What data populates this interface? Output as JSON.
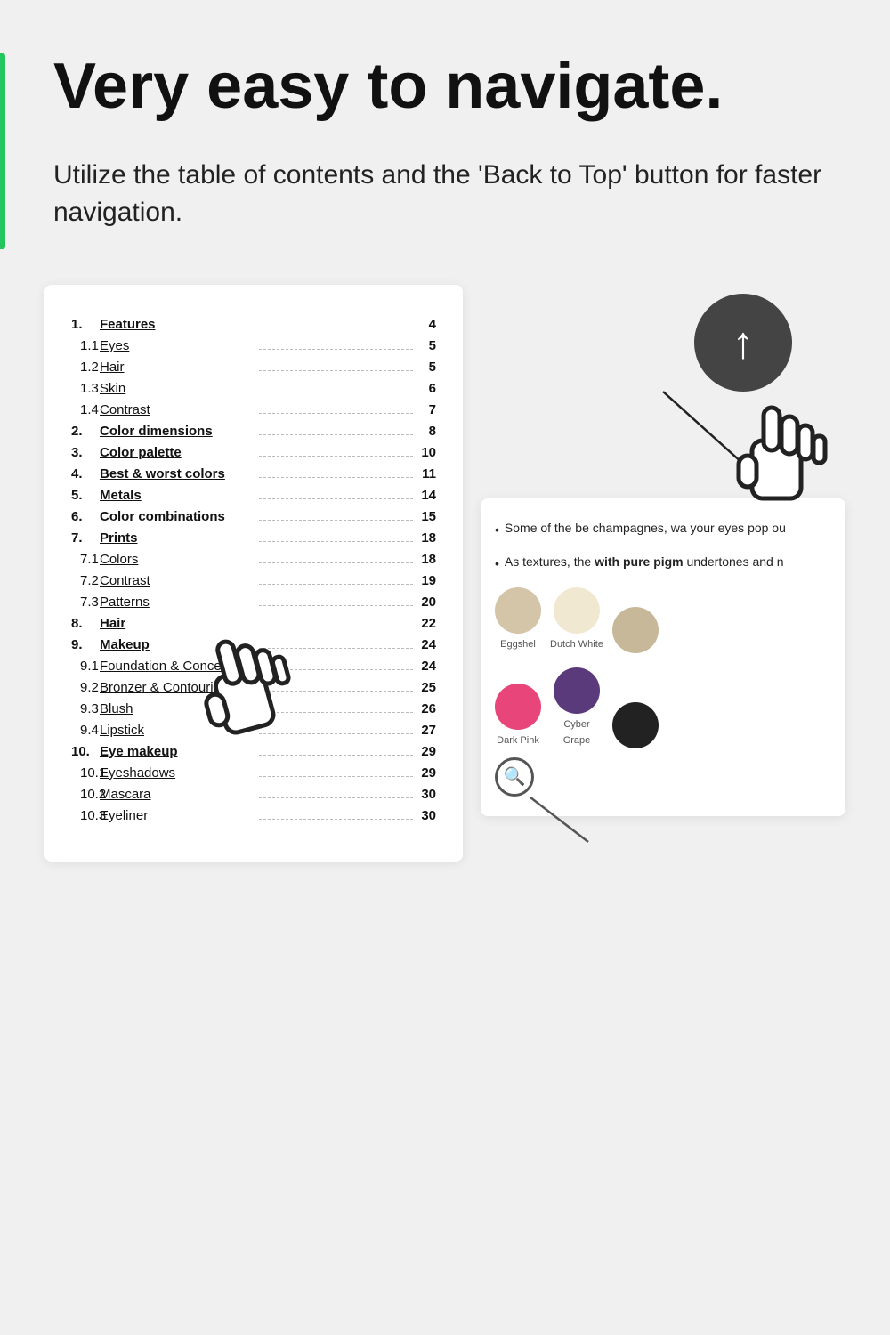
{
  "hero": {
    "title": "Very easy to navigate.",
    "subtitle": "Utilize the table of contents and the 'Back to Top' button for faster navigation."
  },
  "toc": {
    "items": [
      {
        "num": "1.",
        "label": "Features",
        "page": "4",
        "bold": true,
        "indent": 0
      },
      {
        "num": "1.1",
        "label": "Eyes",
        "page": "5",
        "bold": false,
        "indent": 1
      },
      {
        "num": "1.2",
        "label": "Hair",
        "page": "5",
        "bold": false,
        "indent": 1
      },
      {
        "num": "1.3",
        "label": "Skin",
        "page": "6",
        "bold": false,
        "indent": 1
      },
      {
        "num": "1.4",
        "label": "Contrast",
        "page": "7",
        "bold": false,
        "indent": 1
      },
      {
        "num": "2.",
        "label": "Color dimensions",
        "page": "8",
        "bold": true,
        "indent": 0
      },
      {
        "num": "3.",
        "label": "Color palette",
        "page": "10",
        "bold": true,
        "indent": 0
      },
      {
        "num": "4.",
        "label": "Best & worst colors",
        "page": "11",
        "bold": true,
        "indent": 0
      },
      {
        "num": "5.",
        "label": "Metals",
        "page": "14",
        "bold": true,
        "indent": 0
      },
      {
        "num": "6.",
        "label": "Color combinations",
        "page": "15",
        "bold": true,
        "indent": 0
      },
      {
        "num": "7.",
        "label": "Prints",
        "page": "18",
        "bold": true,
        "indent": 0
      },
      {
        "num": "7.1",
        "label": "Colors",
        "page": "18",
        "bold": false,
        "indent": 1
      },
      {
        "num": "7.2",
        "label": "Contrast",
        "page": "19",
        "bold": false,
        "indent": 1
      },
      {
        "num": "7.3",
        "label": "Patterns",
        "page": "20",
        "bold": false,
        "indent": 1
      },
      {
        "num": "8.",
        "label": "Hair",
        "page": "22",
        "bold": true,
        "indent": 0
      },
      {
        "num": "9.",
        "label": "Makeup",
        "page": "24",
        "bold": true,
        "indent": 0
      },
      {
        "num": "9.1",
        "label": "Foundation & Concealer",
        "page": "24",
        "bold": false,
        "indent": 1
      },
      {
        "num": "9.2",
        "label": "Bronzer & Contouring",
        "page": "25",
        "bold": false,
        "indent": 1
      },
      {
        "num": "9.3",
        "label": "Blush",
        "page": "26",
        "bold": false,
        "indent": 1
      },
      {
        "num": "9.4",
        "label": "Lipstick",
        "page": "27",
        "bold": false,
        "indent": 1
      },
      {
        "num": "10.",
        "label": "Eye makeup",
        "page": "29",
        "bold": true,
        "indent": 0
      },
      {
        "num": "10.1",
        "label": "Eyeshadows",
        "page": "29",
        "bold": false,
        "indent": 1
      },
      {
        "num": "10.2",
        "label": "Mascara",
        "page": "30",
        "bold": false,
        "indent": 1
      },
      {
        "num": "10.3",
        "label": "Eyeliner",
        "page": "30",
        "bold": false,
        "indent": 1
      }
    ]
  },
  "content_preview": {
    "bullet1": "Some of the be champagnes, wa your eyes pop ou",
    "bullet2_pre": "As textures, the ",
    "bullet2_bold": "with pure pigm",
    "bullet2_post": " undertones and n",
    "swatches": [
      {
        "label": "Eggshel",
        "color": "#d4c5a9"
      },
      {
        "label": "Dutch White",
        "color": "#f0e8d0"
      },
      {
        "label": "",
        "color": "#c8b89a"
      },
      {
        "label": "Dark Pink",
        "color": "#e8457a"
      },
      {
        "label": "Cyber Grape",
        "color": "#5a3a7a"
      },
      {
        "label": "",
        "color": "#222222"
      }
    ]
  },
  "back_to_top": {
    "label": "↑"
  }
}
